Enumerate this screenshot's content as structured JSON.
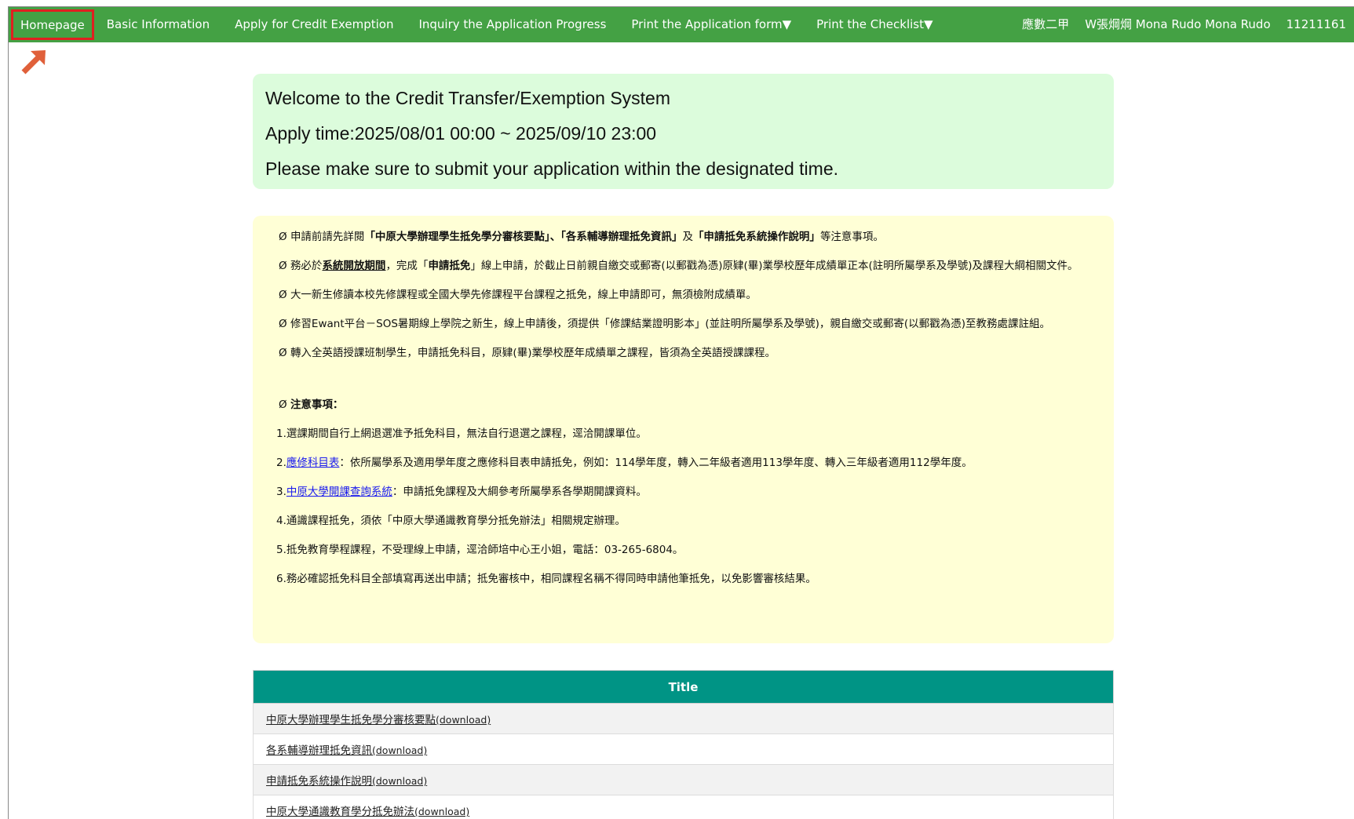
{
  "nav": {
    "homepage": "Homepage",
    "basic_info": "Basic Information",
    "apply": "Apply for Credit Exemption",
    "inquiry": "Inquiry the Application Progress",
    "print_form": "Print the Application form▼",
    "print_checklist": "Print the Checklist▼",
    "class": "應數二甲",
    "user_name": "W張焵焵 Mona Rudo Mona Rudo",
    "student_id": "11211161"
  },
  "welcome": {
    "line1": "Welcome to the Credit Transfer/Exemption System",
    "line2": "Apply time:2025/08/01 00:00 ~ 2025/09/10 23:00",
    "line3": "Please make sure to submit your application within the designated time."
  },
  "notice": {
    "bullet": "Ø",
    "p1_a": "申請前請先詳閱",
    "p1_b1": "「中原大學辦理學生抵免學分審核要點」",
    "p1_sep": "、",
    "p1_b2": "「各系輔導辦理抵免資訊」",
    "p1_c": "及",
    "p1_b3": "「申請抵免系統操作說明」",
    "p1_d": "等注意事項。",
    "p2_a": "務必於",
    "p2_u": "系統開放期間",
    "p2_b": "，完成「",
    "p2_bold": "申請抵免",
    "p2_c": "」線上申請，於截止日前親自繳交或郵寄(以郵戳為憑)原肄(畢)業學校歷年成績單正本(註明所屬學系及學號)及課程大綱相關文件。",
    "p3": "大一新生修讀本校先修課程或全國大學先修課程平台課程之抵免，線上申請即可，無須檢附成績單。",
    "p4": "修習Ewant平台－SOS暑期線上學院之新生，線上申請後，須提供「修課結業證明影本」(並註明所屬學系及學號)，親自繳交或郵寄(以郵戳為憑)至教務處課註組。",
    "p5": "轉入全英語授課班制學生，申請抵免科目，原肄(畢)業學校歷年成績單之課程，皆須為全英語授課課程。",
    "attention_title": "注意事項：",
    "n1": "1.選課期間自行上網退選准予抵免科目，無法自行退選之課程，逕洽開課單位。",
    "n2_prefix": "2.",
    "n2_link": "應修科目表",
    "n2_text": "：依所屬學系及適用學年度之應修科目表申請抵免，例如：114學年度，轉入二年級者適用113學年度、轉入三年級者適用112學年度。",
    "n3_prefix": "3.",
    "n3_link": "中原大學開課查詢系統",
    "n3_text": "：申請抵免課程及大綱參考所屬學系各學期開課資料。",
    "n4": "4.通識課程抵免，須依「中原大學通識教育學分抵免辦法」相關規定辦理。",
    "n5": "5.抵免教育學程課程，不受理線上申請，逕洽師培中心王小姐，電話：03-265-6804。",
    "n6": "6.務必確認抵免科目全部填寫再送出申請；抵免審核中，相同課程名稱不得同時申請他筆抵免，以免影響審核結果。"
  },
  "table": {
    "header": "Title",
    "download_label": "(download)",
    "rows": [
      {
        "title": "中原大學辦理學生抵免學分審核要點"
      },
      {
        "title": "各系輔導辦理抵免資訊"
      },
      {
        "title": "申請抵免系統操作說明"
      },
      {
        "title": "中原大學通識教育學分抵免辦法"
      }
    ]
  },
  "colors": {
    "navbar": "#44a144",
    "highlight_border": "#e02020",
    "welcome_bg": "#dcfcdc",
    "notice_bg": "#ffffd6",
    "table_header": "#009485"
  }
}
